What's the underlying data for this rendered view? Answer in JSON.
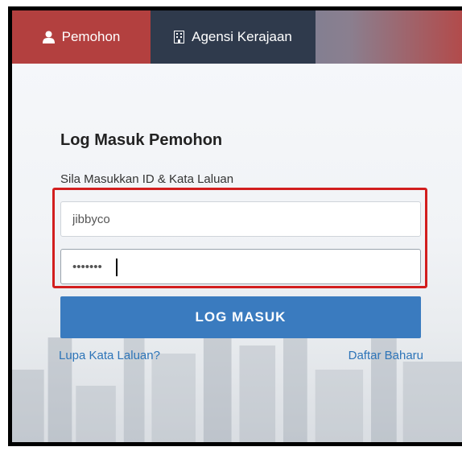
{
  "tabs": [
    {
      "label": "Pemohon",
      "icon": "user-icon",
      "active": true
    },
    {
      "label": "Agensi Kerajaan",
      "icon": "building-icon",
      "active": false
    }
  ],
  "login": {
    "heading": "Log Masuk Pemohon",
    "instruction": "Sila Masukkan ID & Kata Laluan",
    "username_value": "jibbyco",
    "password_value": "•••••••",
    "submit_label": "LOG MASUK",
    "forgot_link": "Lupa Kata Laluan?",
    "register_link": "Daftar Baharu"
  },
  "colors": {
    "active_tab": "#b3403f",
    "inactive_tab": "#2f3a4c",
    "button": "#3a7bbf",
    "link": "#2d74b8",
    "highlight_border": "#d21e1e"
  }
}
